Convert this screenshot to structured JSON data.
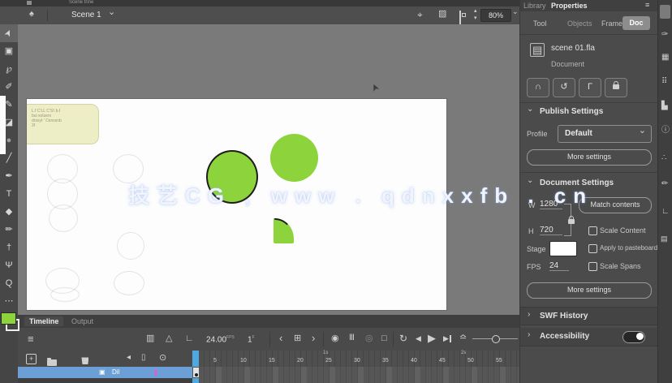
{
  "top_strip": {
    "title": "Scene trine"
  },
  "edit_bar": {
    "scene": "Scene 1",
    "zoom": "80%"
  },
  "stage": {
    "watermark": "技艺CG , www . qdnxxfb . cn",
    "sticky_note": [
      "L.f C'LL C'S'i b.f",
      "bui soluers",
      "drssyt ' Censsnb",
      "2f"
    ]
  },
  "properties_panel": {
    "header": {
      "library": "Library",
      "properties": "Properties"
    },
    "tabs": {
      "tool": "Tool",
      "objects": "Objects",
      "frame": "Frame",
      "doc": "Doc"
    },
    "doc_info": {
      "name": "scene 01.fla",
      "type": "Document"
    },
    "publish": {
      "title": "Publish Settings",
      "profile_label": "Profile",
      "profile_value": "Default",
      "more_button": "More settings"
    },
    "document_settings": {
      "title": "Document Settings",
      "w_label": "W",
      "w_value": "1280",
      "h_label": "H",
      "h_value": "720",
      "match_button": "Match contents",
      "scale_content": "Scale Content",
      "stage_label": "Stage",
      "apply_pasteboard": "Apply to pasteboard",
      "fps_label": "FPS",
      "fps_value": "24",
      "scale_spans": "Scale Spans",
      "more_button": "More settings"
    },
    "swf_history": "SWF History",
    "accessibility": "Accessibility"
  },
  "timeline": {
    "tab_timeline": "Timeline",
    "tab_output": "Output",
    "fps": "24.00",
    "fps_unit": "FPS",
    "frame": "1",
    "frame_unit": "F",
    "ruler_numbers": [
      "5",
      "10",
      "15",
      "20",
      "25",
      "30",
      "35",
      "40",
      "45",
      "50",
      "55"
    ],
    "seconds": [
      "1s",
      "2s"
    ],
    "layer_name": "Dil"
  },
  "colors": {
    "shape_green": "#8dd43c",
    "layer_selection_blue": "#6b9fd6",
    "playhead_blue": "#4da9e0",
    "sticky_yellow": "#eeeec6",
    "stage_white": "#fdfdfd"
  },
  "glyphs": {
    "plus": "+",
    "home": "♠",
    "chevron_down": "⌄",
    "crosshair": "⌖",
    "clip": "▨",
    "stepper_up": "▴",
    "stepper_down": "▾",
    "menu": "≡",
    "selection": "➤",
    "subselection": "▣",
    "lasso": "℘",
    "fluid_brush": "✐",
    "classic_brush": "✎",
    "eraser": "◪",
    "oval": "●",
    "line": "╱",
    "pen": "✒",
    "text": "T",
    "bucket": "◆",
    "pencil": "✏",
    "pin": "†",
    "hand": "Ψ",
    "zoom": "Q",
    "more": "⋯",
    "undo": "↶",
    "redo": "↷",
    "snap": "∩",
    "history": "↺",
    "corner": "Γ",
    "doc_file": "▤",
    "layers": "≡",
    "camera": "▥",
    "warn": "△",
    "chart": "∟",
    "prev": "‹",
    "insert_frame": "⊞",
    "next": "›",
    "onion": "◉",
    "onion_outline": "Ⅲ",
    "onion_faded": "◎",
    "multi_frame": "□",
    "loop": "↻",
    "step_back": "◀",
    "play": "▶",
    "step_fwd": "▶",
    "wave": "≏",
    "back_small": "◂",
    "marker": "▯",
    "eye": "⊙",
    "doc_small": "▣",
    "cursor": "➤"
  },
  "dock": [
    "✑",
    "▦",
    "⠿",
    "▙",
    "ⓘ",
    "∴",
    "✏",
    "∟",
    "▤"
  ]
}
